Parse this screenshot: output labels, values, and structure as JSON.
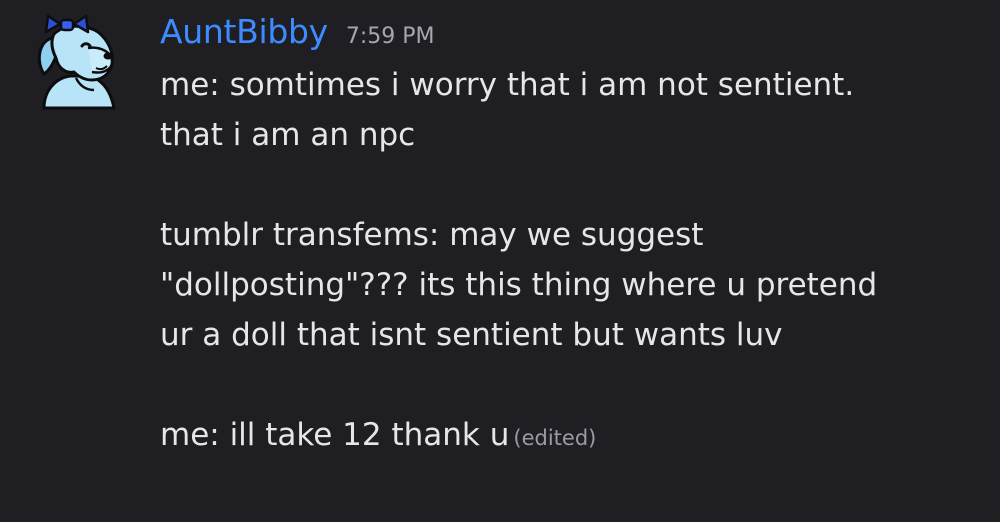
{
  "message": {
    "author": "AuntBibby",
    "timestamp": "7:59 PM",
    "avatar_icon": "blue-cartoon-dog-with-bow-icon",
    "username_color": "#3d8bff",
    "edited_label": "(edited)",
    "paragraphs": [
      {
        "lines": [
          "me: somtimes i worry that i am not sentient.",
          "that i am an npc"
        ]
      },
      {
        "lines": [
          "tumblr transfems: may we suggest",
          "\"dollposting\"??? its this thing where u pretend",
          "ur a doll that isnt sentient but wants luv"
        ]
      },
      {
        "lines": [
          "me: ill take 12 thank u"
        ]
      }
    ]
  },
  "colors": {
    "background": "#1f1f23",
    "text": "#e6e6ea",
    "muted": "#a6a6b0"
  }
}
